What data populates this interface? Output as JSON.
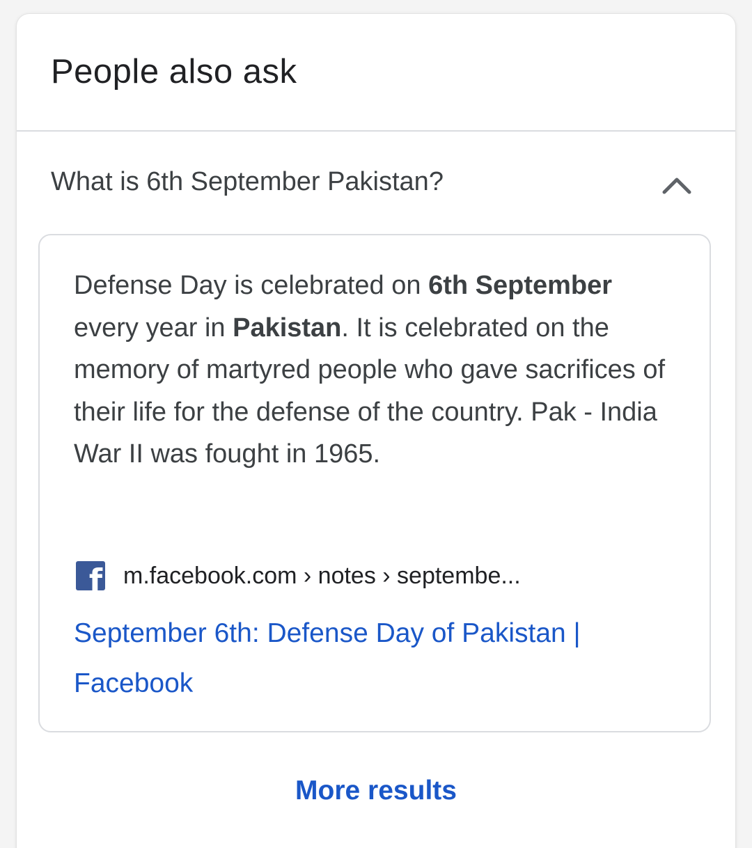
{
  "section": {
    "title": "People also ask"
  },
  "question": {
    "text": "What is 6th September Pakistan?",
    "expanded_icon": "chevron-up-icon"
  },
  "answer": {
    "segments": [
      {
        "text": "Defense Day is celebrated on ",
        "bold": false
      },
      {
        "text": "6th September",
        "bold": true
      },
      {
        "text": " every year in ",
        "bold": false
      },
      {
        "text": "Pakistan",
        "bold": true
      },
      {
        "text": ". It is celebrated on the memory of martyred people who gave sacrifices of their life for the defense of the country. Pak - India War II was fought in 1965.",
        "bold": false
      }
    ]
  },
  "source": {
    "icon": "facebook-icon",
    "icon_letter": "f",
    "url": "m.facebook.com › notes › septembe...",
    "link_title": "September 6th: Defense Day of Pakistan | Facebook",
    "link_color": "#1a57c8",
    "icon_color": "#3b5998"
  },
  "footer": {
    "more_results_label": "More results"
  }
}
